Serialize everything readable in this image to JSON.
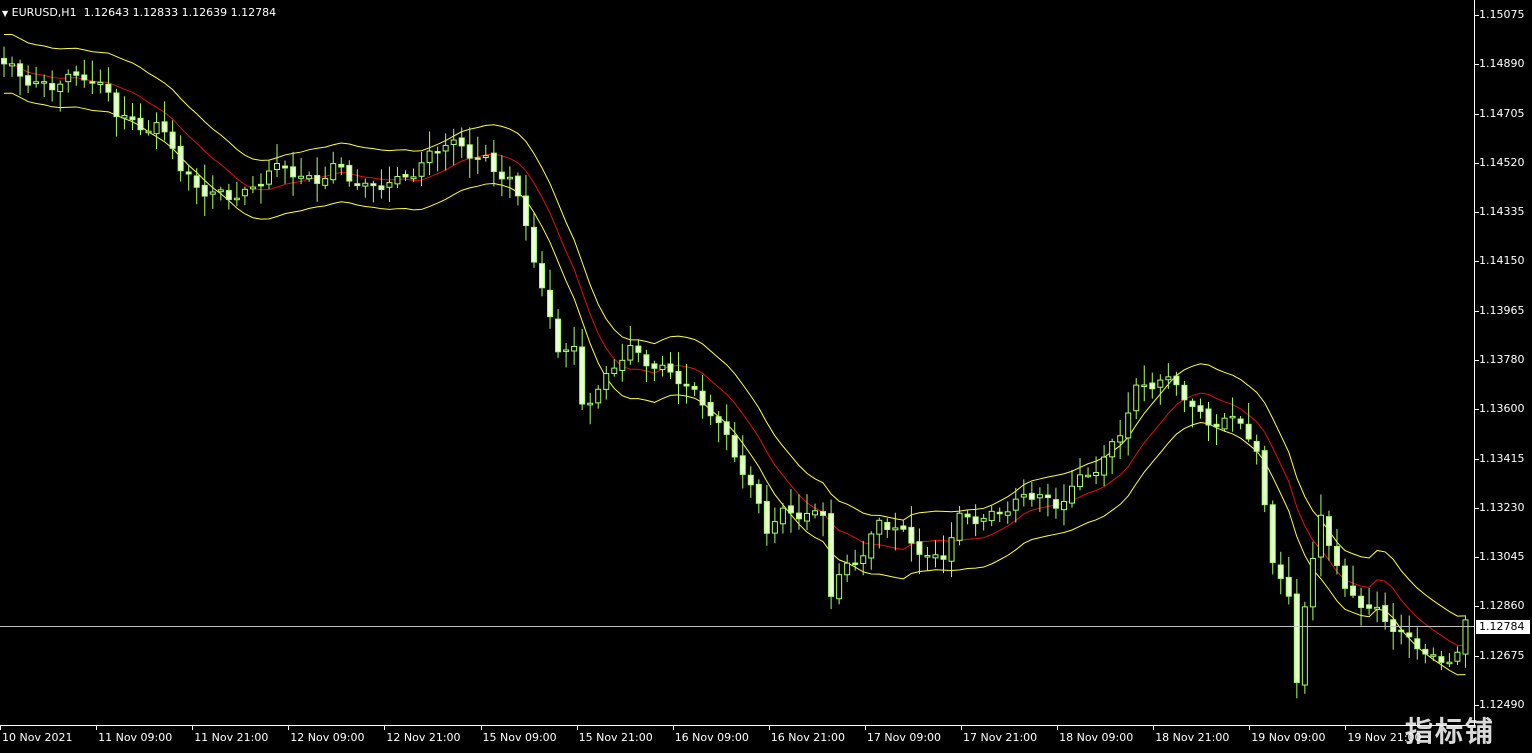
{
  "chart_header": {
    "symbol_timeframe": "EURUSD,H1",
    "open": "1.12643",
    "high": "1.12833",
    "low": "1.12639",
    "close": "1.12784",
    "arrow_icon": "dropdown-triangle-icon"
  },
  "price_scale": {
    "labels": [
      "1.15075",
      "1.14890",
      "1.14705",
      "1.14520",
      "1.14335",
      "1.14150",
      "1.13965",
      "1.13780",
      "1.13600",
      "1.13415",
      "1.13230",
      "1.13045",
      "1.12860",
      "1.12675",
      "1.12490"
    ],
    "current_price": "1.12784"
  },
  "time_scale": {
    "labels": [
      "10 Nov 2021",
      "11 Nov 09:00",
      "11 Nov 21:00",
      "12 Nov 09:00",
      "12 Nov 21:00",
      "15 Nov 09:00",
      "15 Nov 21:00",
      "16 Nov 09:00",
      "16 Nov 21:00",
      "17 Nov 09:00",
      "17 Nov 21:00",
      "18 Nov 09:00",
      "18 Nov 21:00",
      "19 Nov 09:00",
      "19 Nov 21:00"
    ]
  },
  "watermark_text": "指标铺",
  "colors": {
    "background": "#000000",
    "candle": "#a8ff6a",
    "candle_body": "#eaffd8",
    "upper_band": "#ffff3a",
    "lower_band": "#ffff3a",
    "middle_band": "#e01010",
    "grid_text": "#ffffff",
    "current_price_line": "#c0c0c0"
  },
  "chart_data": {
    "type": "candlestick",
    "symbol": "EURUSD",
    "timeframe": "H1",
    "y_axis_labels": [
      "1.15075",
      "1.14890",
      "1.14705",
      "1.14520",
      "1.14335",
      "1.14150",
      "1.13965",
      "1.13780",
      "1.13600",
      "1.13415",
      "1.13230",
      "1.13045",
      "1.12860",
      "1.12675",
      "1.12490"
    ],
    "ylim": [
      1.1243,
      1.1516
    ],
    "current_price": 1.12784,
    "x_labels": [
      "10 Nov 2021",
      "11 Nov 09:00",
      "11 Nov 21:00",
      "12 Nov 09:00",
      "12 Nov 21:00",
      "15 Nov 09:00",
      "15 Nov 21:00",
      "16 Nov 09:00",
      "16 Nov 21:00",
      "17 Nov 09:00",
      "17 Nov 21:00",
      "18 Nov 09:00",
      "18 Nov 21:00",
      "19 Nov 09:00",
      "19 Nov 21:00"
    ],
    "close_path": [
      [
        0,
        1.1488
      ],
      [
        6,
        1.148
      ],
      [
        10,
        1.1486
      ],
      [
        13,
        1.1478
      ],
      [
        14,
        1.147
      ],
      [
        16,
        1.1467
      ],
      [
        19,
        1.1466
      ],
      [
        21,
        1.1458
      ],
      [
        22,
        1.1449
      ],
      [
        24,
        1.1444
      ],
      [
        26,
        1.1441
      ],
      [
        28,
        1.1438
      ],
      [
        31,
        1.1443
      ],
      [
        33,
        1.145
      ],
      [
        36,
        1.1448
      ],
      [
        39,
        1.1446
      ],
      [
        41,
        1.145
      ],
      [
        43,
        1.1446
      ],
      [
        45,
        1.1444
      ],
      [
        47,
        1.1444
      ],
      [
        49,
        1.1444
      ],
      [
        51,
        1.1449
      ],
      [
        53,
        1.1456
      ],
      [
        55,
        1.1459
      ],
      [
        57,
        1.1457
      ],
      [
        60,
        1.1454
      ],
      [
        61,
        1.1449
      ],
      [
        63,
        1.1445
      ],
      [
        65,
        1.143
      ],
      [
        67,
        1.1405
      ],
      [
        69,
        1.1382
      ],
      [
        71,
        1.1381
      ],
      [
        72,
        1.1362
      ],
      [
        74,
        1.1368
      ],
      [
        76,
        1.1375
      ],
      [
        78,
        1.1382
      ],
      [
        81,
        1.1377
      ],
      [
        84,
        1.137
      ],
      [
        86,
        1.1366
      ],
      [
        88,
        1.136
      ],
      [
        90,
        1.1348
      ],
      [
        92,
        1.1336
      ],
      [
        94,
        1.1325
      ],
      [
        95,
        1.1316
      ],
      [
        97,
        1.132
      ],
      [
        99,
        1.132
      ],
      [
        102,
        1.1322
      ],
      [
        103,
        1.1291
      ],
      [
        105,
        1.13
      ],
      [
        107,
        1.1306
      ],
      [
        109,
        1.1319
      ],
      [
        111,
        1.1314
      ],
      [
        113,
        1.131
      ],
      [
        115,
        1.1305
      ],
      [
        117,
        1.1305
      ],
      [
        119,
        1.1318
      ],
      [
        122,
        1.132
      ],
      [
        125,
        1.1322
      ],
      [
        127,
        1.1326
      ],
      [
        129,
        1.133
      ],
      [
        131,
        1.1322
      ],
      [
        133,
        1.133
      ],
      [
        135,
        1.1336
      ],
      [
        137,
        1.1342
      ],
      [
        139,
        1.135
      ],
      [
        141,
        1.1367
      ],
      [
        144,
        1.1372
      ],
      [
        146,
        1.1368
      ],
      [
        148,
        1.136
      ],
      [
        150,
        1.1356
      ],
      [
        152,
        1.1355
      ],
      [
        154,
        1.1355
      ],
      [
        156,
        1.1343
      ],
      [
        157,
        1.1325
      ],
      [
        158,
        1.1305
      ],
      [
        160,
        1.1287
      ],
      [
        161,
        1.1257
      ],
      [
        162,
        1.1287
      ],
      [
        164,
        1.132
      ],
      [
        166,
        1.1302
      ],
      [
        167,
        1.129
      ],
      [
        169,
        1.1287
      ],
      [
        171,
        1.1285
      ],
      [
        173,
        1.1278
      ],
      [
        175,
        1.1272
      ],
      [
        177,
        1.127
      ],
      [
        179,
        1.1265
      ],
      [
        181,
        1.1268
      ],
      [
        182,
        1.1278
      ]
    ],
    "band_period": "hourly",
    "series": [
      {
        "name": "Upper band",
        "color": "#ffff3a"
      },
      {
        "name": "Middle band",
        "color": "#e01010"
      },
      {
        "name": "Lower band",
        "color": "#ffff3a"
      }
    ]
  }
}
